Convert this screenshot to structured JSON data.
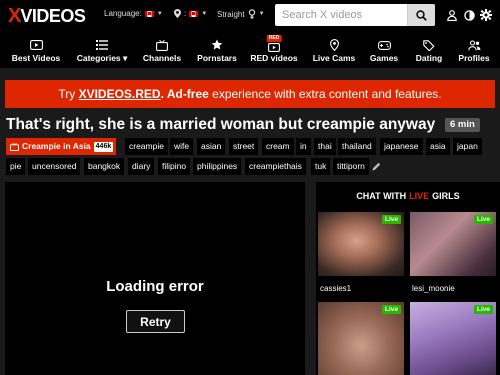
{
  "header": {
    "logo_x": "X",
    "logo_rest": "VIDEOS",
    "language_label": "Language:",
    "country_label": ":",
    "orientation_label": "Straight",
    "search_placeholder": "Search X videos",
    "icons": [
      "search-icon",
      "user-icon",
      "contrast-icon",
      "gear-icon"
    ]
  },
  "nav": {
    "items": [
      {
        "label": "Best Videos",
        "icon": "play-icon"
      },
      {
        "label": "Categories ▾",
        "icon": "list-icon"
      },
      {
        "label": "Channels",
        "icon": "tv-icon"
      },
      {
        "label": "Pornstars",
        "icon": "star-icon"
      },
      {
        "label": "RED videos",
        "icon": "red-icon",
        "badge": "RED"
      },
      {
        "label": "Live Cams",
        "icon": "pin-icon"
      },
      {
        "label": "Games",
        "icon": "gamepad-icon"
      },
      {
        "label": "Dating",
        "icon": "tags-icon"
      },
      {
        "label": "Profiles",
        "icon": "users-icon"
      }
    ]
  },
  "promo": {
    "prefix": "Try ",
    "link": "XVIDEOS.RED",
    "bold": ". Ad-free",
    "suffix": " experience with extra content and features."
  },
  "video": {
    "title": "That's right, she is a married woman but creampie anyway",
    "duration": "6 min",
    "channel_tag": "Creampie in Asia",
    "channel_count": "446k",
    "tags_row1": [
      "creampie",
      "wife",
      "asian",
      "street",
      "cream",
      "in",
      "thai",
      "thailand",
      "japanese",
      "asia",
      "japan"
    ],
    "tags_row2": [
      "pie",
      "uncensored",
      "bangkok",
      "diary",
      "filipino",
      "philippines",
      "creampiethais",
      "tuk",
      "tittiporn"
    ]
  },
  "player": {
    "error_text": "Loading error",
    "retry_label": "Retry"
  },
  "sidebar": {
    "heading_prefix": "CHAT WITH",
    "heading_live": "LIVE",
    "heading_suffix": "GIRLS",
    "cams": [
      {
        "name": "cassies1",
        "badge": "Live"
      },
      {
        "name": "lesi_moonie",
        "badge": "Live"
      },
      {
        "name": "",
        "badge": "Live"
      },
      {
        "name": "",
        "badge": "Live"
      }
    ]
  },
  "colors": {
    "accent": "#de2600",
    "live_badge": "#2ab700",
    "background": "#1a1a1a"
  }
}
